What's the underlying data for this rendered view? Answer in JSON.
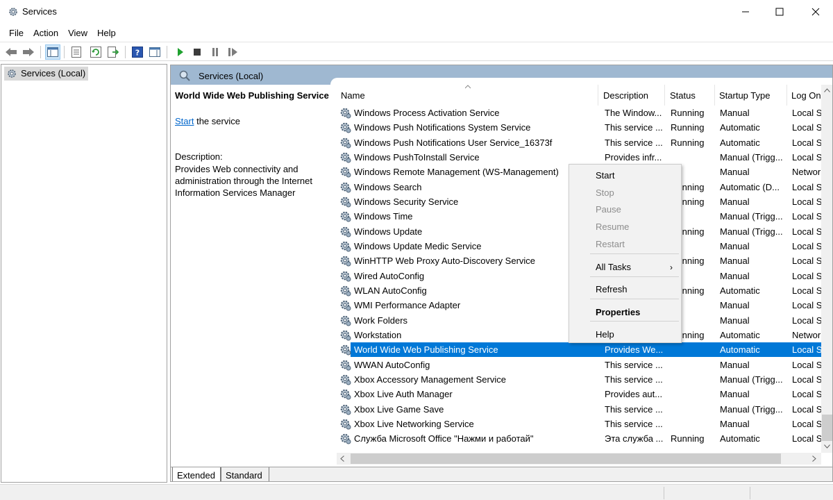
{
  "window": {
    "title": "Services",
    "minimize_glyph": "—",
    "maximize_glyph": "☐",
    "close_glyph": "✕"
  },
  "menu": [
    "File",
    "Action",
    "View",
    "Help"
  ],
  "toolbar": {
    "icons": [
      "back-arrow-icon",
      "forward-arrow-icon",
      "show-hide-console-tree-icon",
      "properties-icon",
      "refresh-icon",
      "export-list-icon",
      "help-icon",
      "show-hide-action-pane-icon",
      "start-service-icon",
      "stop-service-icon",
      "pause-service-icon",
      "resume-service-icon"
    ]
  },
  "tree": {
    "root_label": "Services (Local)"
  },
  "panel": {
    "header": "Services (Local)",
    "extended": {
      "service_title": "World Wide Web Publishing Service",
      "start_link": "Start",
      "start_suffix": " the service",
      "description_label": "Description:",
      "description": "Provides Web connectivity and administration through the Internet Information Services Manager"
    },
    "columns": [
      "Name",
      "Description",
      "Status",
      "Startup Type",
      "Log On As"
    ],
    "rows": [
      {
        "name": "Windows Process Activation Service",
        "desc": "The Window...",
        "status": "Running",
        "startup": "Manual",
        "logon": "Local System"
      },
      {
        "name": "Windows Push Notifications System Service",
        "desc": "This service ...",
        "status": "Running",
        "startup": "Automatic",
        "logon": "Local System"
      },
      {
        "name": "Windows Push Notifications User Service_16373f",
        "desc": "This service ...",
        "status": "Running",
        "startup": "Automatic",
        "logon": "Local System"
      },
      {
        "name": "Windows PushToInstall Service",
        "desc": "Provides infr...",
        "status": "",
        "startup": "Manual (Trigg...",
        "logon": "Local System"
      },
      {
        "name": "Windows Remote Management (WS-Management)",
        "desc": "",
        "status": "",
        "startup": "Manual",
        "logon": "Network Service"
      },
      {
        "name": "Windows Search",
        "desc": "",
        "status": "Running",
        "startup": "Automatic (D...",
        "logon": "Local System"
      },
      {
        "name": "Windows Security Service",
        "desc": "",
        "status": "Running",
        "startup": "Manual",
        "logon": "Local System"
      },
      {
        "name": "Windows Time",
        "desc": "",
        "status": "",
        "startup": "Manual (Trigg...",
        "logon": "Local Service"
      },
      {
        "name": "Windows Update",
        "desc": "",
        "status": "Running",
        "startup": "Manual (Trigg...",
        "logon": "Local System"
      },
      {
        "name": "Windows Update Medic Service",
        "desc": "",
        "status": "",
        "startup": "Manual",
        "logon": "Local System"
      },
      {
        "name": "WinHTTP Web Proxy Auto-Discovery Service",
        "desc": "",
        "status": "Running",
        "startup": "Manual",
        "logon": "Local Service"
      },
      {
        "name": "Wired AutoConfig",
        "desc": "",
        "status": "",
        "startup": "Manual",
        "logon": "Local System"
      },
      {
        "name": "WLAN AutoConfig",
        "desc": "",
        "status": "Running",
        "startup": "Automatic",
        "logon": "Local System"
      },
      {
        "name": "WMI Performance Adapter",
        "desc": "",
        "status": "",
        "startup": "Manual",
        "logon": "Local System"
      },
      {
        "name": "Work Folders",
        "desc": "",
        "status": "",
        "startup": "Manual",
        "logon": "Local Service"
      },
      {
        "name": "Workstation",
        "desc": "",
        "status": "Running",
        "startup": "Automatic",
        "logon": "Network Service"
      },
      {
        "name": "World Wide Web Publishing Service",
        "desc": "Provides We...",
        "status": "",
        "startup": "Automatic",
        "logon": "Local System",
        "selected": true
      },
      {
        "name": "WWAN AutoConfig",
        "desc": "This service ...",
        "status": "",
        "startup": "Manual",
        "logon": "Local System"
      },
      {
        "name": "Xbox Accessory Management Service",
        "desc": "This service ...",
        "status": "",
        "startup": "Manual (Trigg...",
        "logon": "Local System"
      },
      {
        "name": "Xbox Live Auth Manager",
        "desc": "Provides aut...",
        "status": "",
        "startup": "Manual",
        "logon": "Local System"
      },
      {
        "name": "Xbox Live Game Save",
        "desc": "This service ...",
        "status": "",
        "startup": "Manual (Trigg...",
        "logon": "Local System"
      },
      {
        "name": "Xbox Live Networking Service",
        "desc": "This service ...",
        "status": "",
        "startup": "Manual",
        "logon": "Local System"
      },
      {
        "name": "Служба Microsoft Office \"Нажми и работай\"",
        "desc": "Эта служба ...",
        "status": "Running",
        "startup": "Automatic",
        "logon": "Local System"
      }
    ],
    "tabs": [
      "Extended",
      "Standard"
    ]
  },
  "context_menu": {
    "items": [
      {
        "label": "Start",
        "enabled": true
      },
      {
        "label": "Stop",
        "enabled": false
      },
      {
        "label": "Pause",
        "enabled": false
      },
      {
        "label": "Resume",
        "enabled": false
      },
      {
        "label": "Restart",
        "enabled": false
      },
      {
        "label": "All Tasks",
        "enabled": true,
        "submenu": true
      },
      {
        "label": "Refresh",
        "enabled": true
      },
      {
        "label": "Properties",
        "enabled": true,
        "bold": true
      },
      {
        "label": "Help",
        "enabled": true
      }
    ],
    "submenu_glyph": "›"
  },
  "colors": {
    "selection": "#0078d7",
    "panel_header": "#9fb8d1",
    "link": "#0066cc",
    "play_green": "#1fa12f"
  }
}
